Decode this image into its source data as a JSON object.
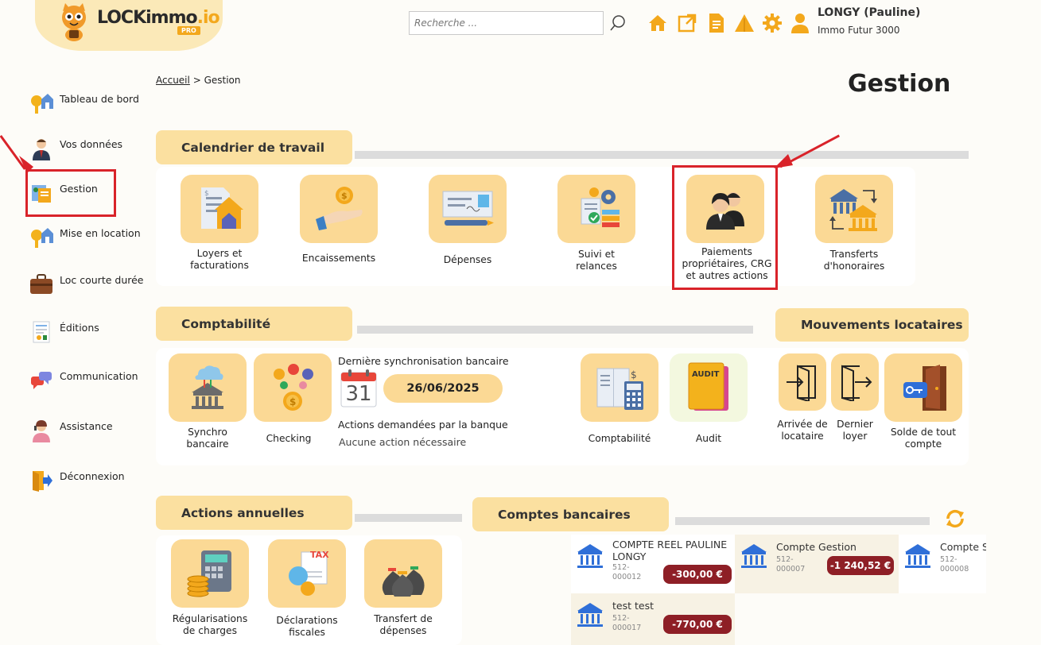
{
  "header": {
    "logo_main": "LOCKimmo",
    "logo_io": ".io",
    "logo_badge": "PRO",
    "search_placeholder": "Recherche ...",
    "user_name": "LONGY (Pauline)",
    "user_org": "Immo Futur 3000",
    "icons": [
      "search-icon",
      "home-icon",
      "external-link-icon",
      "document-icon",
      "alert-icon",
      "gear-icon",
      "user-icon"
    ]
  },
  "sidebar": {
    "items": [
      {
        "label": "Tableau de bord",
        "icon": "key-house-icon"
      },
      {
        "label": "Vos données",
        "icon": "person-icon"
      },
      {
        "label": "Gestion",
        "icon": "management-icon"
      },
      {
        "label": "Mise en location",
        "icon": "key-house-icon"
      },
      {
        "label": "Loc courte durée",
        "icon": "suitcase-icon"
      },
      {
        "label": "Éditions",
        "icon": "report-icon"
      },
      {
        "label": "Communication",
        "icon": "chat-icon"
      },
      {
        "label": "Assistance",
        "icon": "support-agent-icon"
      },
      {
        "label": "Déconnexion",
        "icon": "logout-icon"
      }
    ]
  },
  "breadcrumb": {
    "home": "Accueil",
    "sep": ">",
    "current": "Gestion"
  },
  "page_title": "Gestion",
  "calendar": {
    "title": "Calendrier de travail",
    "tiles": [
      {
        "label1": "Loyers et",
        "label2": "facturations"
      },
      {
        "label1": "Encaissements",
        "label2": ""
      },
      {
        "label1": "Dépenses",
        "label2": ""
      },
      {
        "label1": "Suivi et",
        "label2": "relances"
      },
      {
        "label1": "Paiements",
        "label2": "propriétaires, CRG",
        "label3": "et autres actions"
      },
      {
        "label1": "Transferts",
        "label2": "d'honoraires"
      }
    ]
  },
  "compta": {
    "title": "Comptabilité",
    "tiles": [
      {
        "label1": "Synchro",
        "label2": "bancaire"
      },
      {
        "label1": "Checking",
        "label2": ""
      },
      {
        "label1": "Comptabilité",
        "label2": ""
      },
      {
        "label1": "Audit",
        "label2": ""
      }
    ],
    "sync_label": "Dernière synchronisation bancaire",
    "calendar_day": "31",
    "sync_date": "26/06/2025",
    "bank_actions_label": "Actions demandées par la banque",
    "bank_actions_value": "Aucune action nécessaire",
    "audit_badge": "AUDIT"
  },
  "mouvements": {
    "title": "Mouvements locataires",
    "tiles": [
      {
        "label1": "Arrivée de",
        "label2": "locataire"
      },
      {
        "label1": "Dernier",
        "label2": "loyer"
      },
      {
        "label1": "Solde de tout",
        "label2": "compte"
      }
    ]
  },
  "annuelles": {
    "title": "Actions annuelles",
    "tiles": [
      {
        "label1": "Régularisations",
        "label2": "de charges"
      },
      {
        "label1": "Déclarations",
        "label2": "fiscales"
      },
      {
        "label1": "Transfert de",
        "label2": "dépenses"
      }
    ],
    "tax_badge": "TAX"
  },
  "comptes": {
    "title": "Comptes bancaires",
    "accounts": [
      {
        "name1": "COMPTE REEL PAULINE",
        "name2": "LONGY",
        "num1": "512-",
        "num2": "000012",
        "amount": "-300,00 €"
      },
      {
        "name1": "Compte Gestion",
        "name2": "",
        "num1": "512-",
        "num2": "000007",
        "amount": "-1 240,52 €"
      },
      {
        "name1": "Compte S",
        "name2": "",
        "num1": "512-",
        "num2": "000008",
        "amount": ""
      },
      {
        "name1": "test test",
        "name2": "",
        "num1": "512-",
        "num2": "000017",
        "amount": "-770,00 €"
      }
    ]
  },
  "colors": {
    "accent": "#fbd995",
    "tab": "#fbe0a0",
    "orange": "#f3a81c",
    "red_highlight": "#d9232a",
    "amount_bg": "#8e1f26"
  }
}
